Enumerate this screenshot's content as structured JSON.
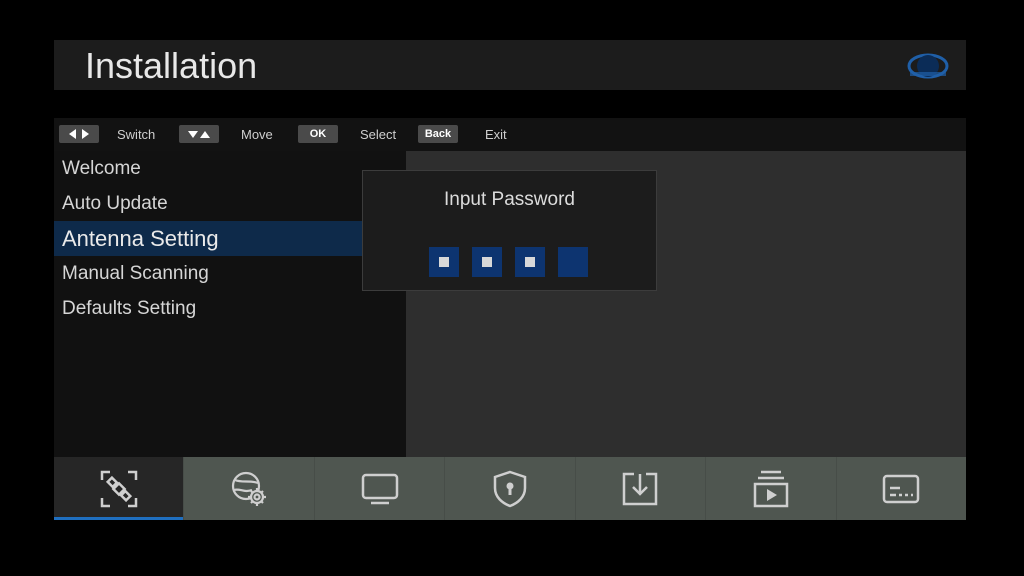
{
  "header": {
    "title": "Installation"
  },
  "hints": [
    {
      "key_icon": "left-right-arrows-icon",
      "label": "Switch"
    },
    {
      "key_icon": "up-down-arrows-icon",
      "label": "Move"
    },
    {
      "key": "OK",
      "label": "Select"
    },
    {
      "key": "Back",
      "label": "Exit"
    }
  ],
  "menu": {
    "items": [
      {
        "label": "Welcome"
      },
      {
        "label": "Auto Update"
      },
      {
        "label": "Antenna Setting",
        "selected": true
      },
      {
        "label": "Manual Scanning"
      },
      {
        "label": "Defaults Setting"
      }
    ]
  },
  "dialog": {
    "title": "Input Password",
    "digits_entered": 3,
    "digits_total": 4
  },
  "tabs": [
    {
      "icon": "satellite-icon",
      "selected": true
    },
    {
      "icon": "network-settings-icon"
    },
    {
      "icon": "tv-icon"
    },
    {
      "icon": "shield-lock-icon"
    },
    {
      "icon": "download-icon"
    },
    {
      "icon": "media-playlist-icon"
    },
    {
      "icon": "subtitle-icon"
    }
  ],
  "colors": {
    "selection": "#0e2a4a",
    "pin_box": "#0d3470",
    "tab_indicator": "#1f6fc0"
  }
}
